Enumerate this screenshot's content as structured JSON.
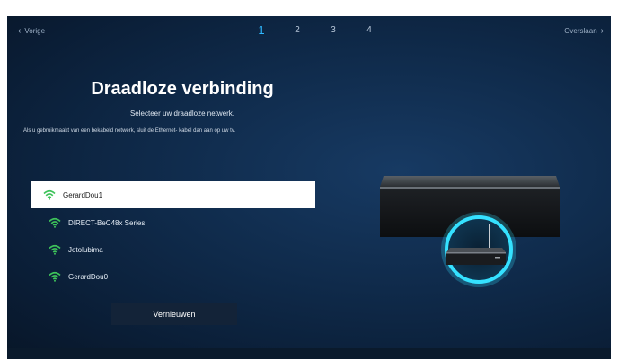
{
  "nav": {
    "back_label": "Vorige",
    "skip_label": "Overslaan"
  },
  "steps": [
    "1",
    "2",
    "3",
    "4"
  ],
  "active_step": "1",
  "title": "Draadloze verbinding",
  "subtitle": "Selecteer uw draadloze netwerk.",
  "note": "Als u gebruikmaakt van een bekabeld netwerk, sluit de Ethernet- kabel dan aan op uw tv.",
  "networks": [
    {
      "name": "GerardDou1",
      "selected": true
    },
    {
      "name": "DIRECT-BeC48x Series",
      "selected": false
    },
    {
      "name": "Jotolubima",
      "selected": false
    },
    {
      "name": "GerardDou0",
      "selected": false
    }
  ],
  "refresh_label": "Vernieuwen",
  "colors": {
    "accent": "#2fb8ff",
    "wifi": "#3ec35a",
    "glow": "#35e1ff",
    "background": "#0f2a4a"
  },
  "icons": {
    "back": "chevron-left-icon",
    "skip": "chevron-right-icon",
    "wifi": "wifi-icon"
  }
}
